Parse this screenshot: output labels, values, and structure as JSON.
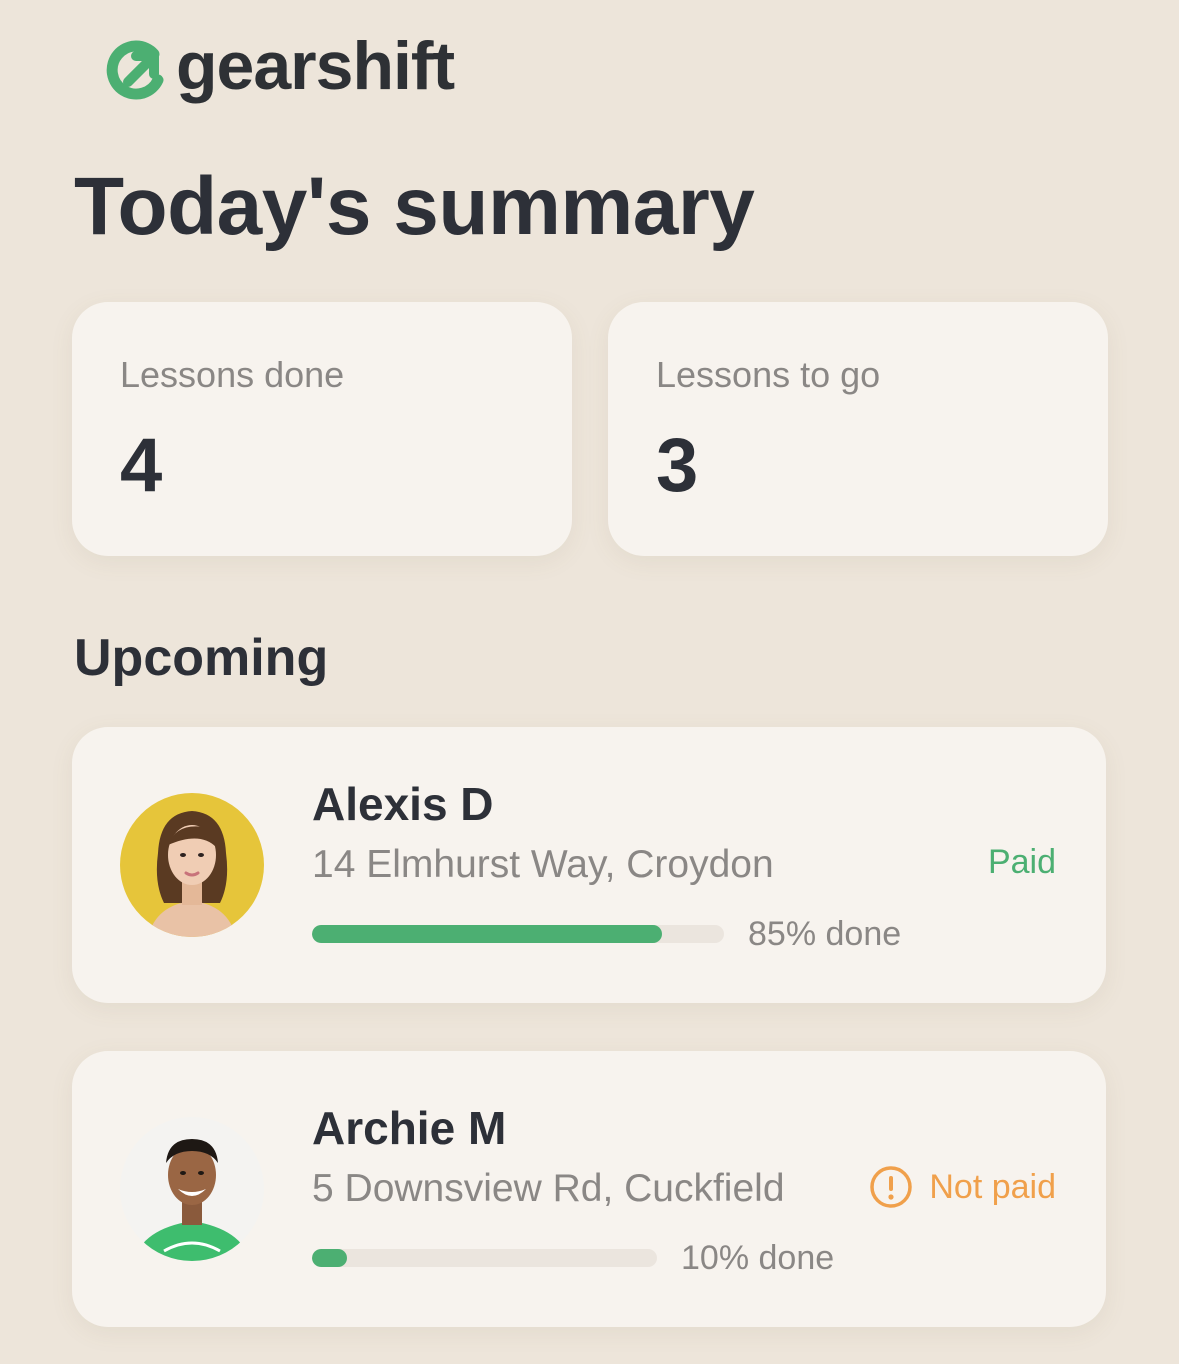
{
  "brand": {
    "name": "gearshift",
    "icon": "gearshift-logo-icon",
    "accent": "#4caf72"
  },
  "page": {
    "title": "Today's summary"
  },
  "stats": [
    {
      "label": "Lessons done",
      "value": "4"
    },
    {
      "label": "Lessons to go",
      "value": "3"
    }
  ],
  "upcoming": {
    "title": "Upcoming",
    "lessons": [
      {
        "name": "Alexis D",
        "address": "14 Elmhurst Way, Croydon",
        "progress": 0.85,
        "progress_text": "85% done",
        "status": "Paid",
        "status_color": "#4caf72"
      },
      {
        "name": "Archie M",
        "address": "5 Downsview Rd, Cuckfield",
        "progress": 0.1,
        "progress_text": "10% done",
        "status": "Not paid",
        "status_icon": "alert-circle-icon",
        "status_color": "#f0a04b"
      }
    ]
  }
}
